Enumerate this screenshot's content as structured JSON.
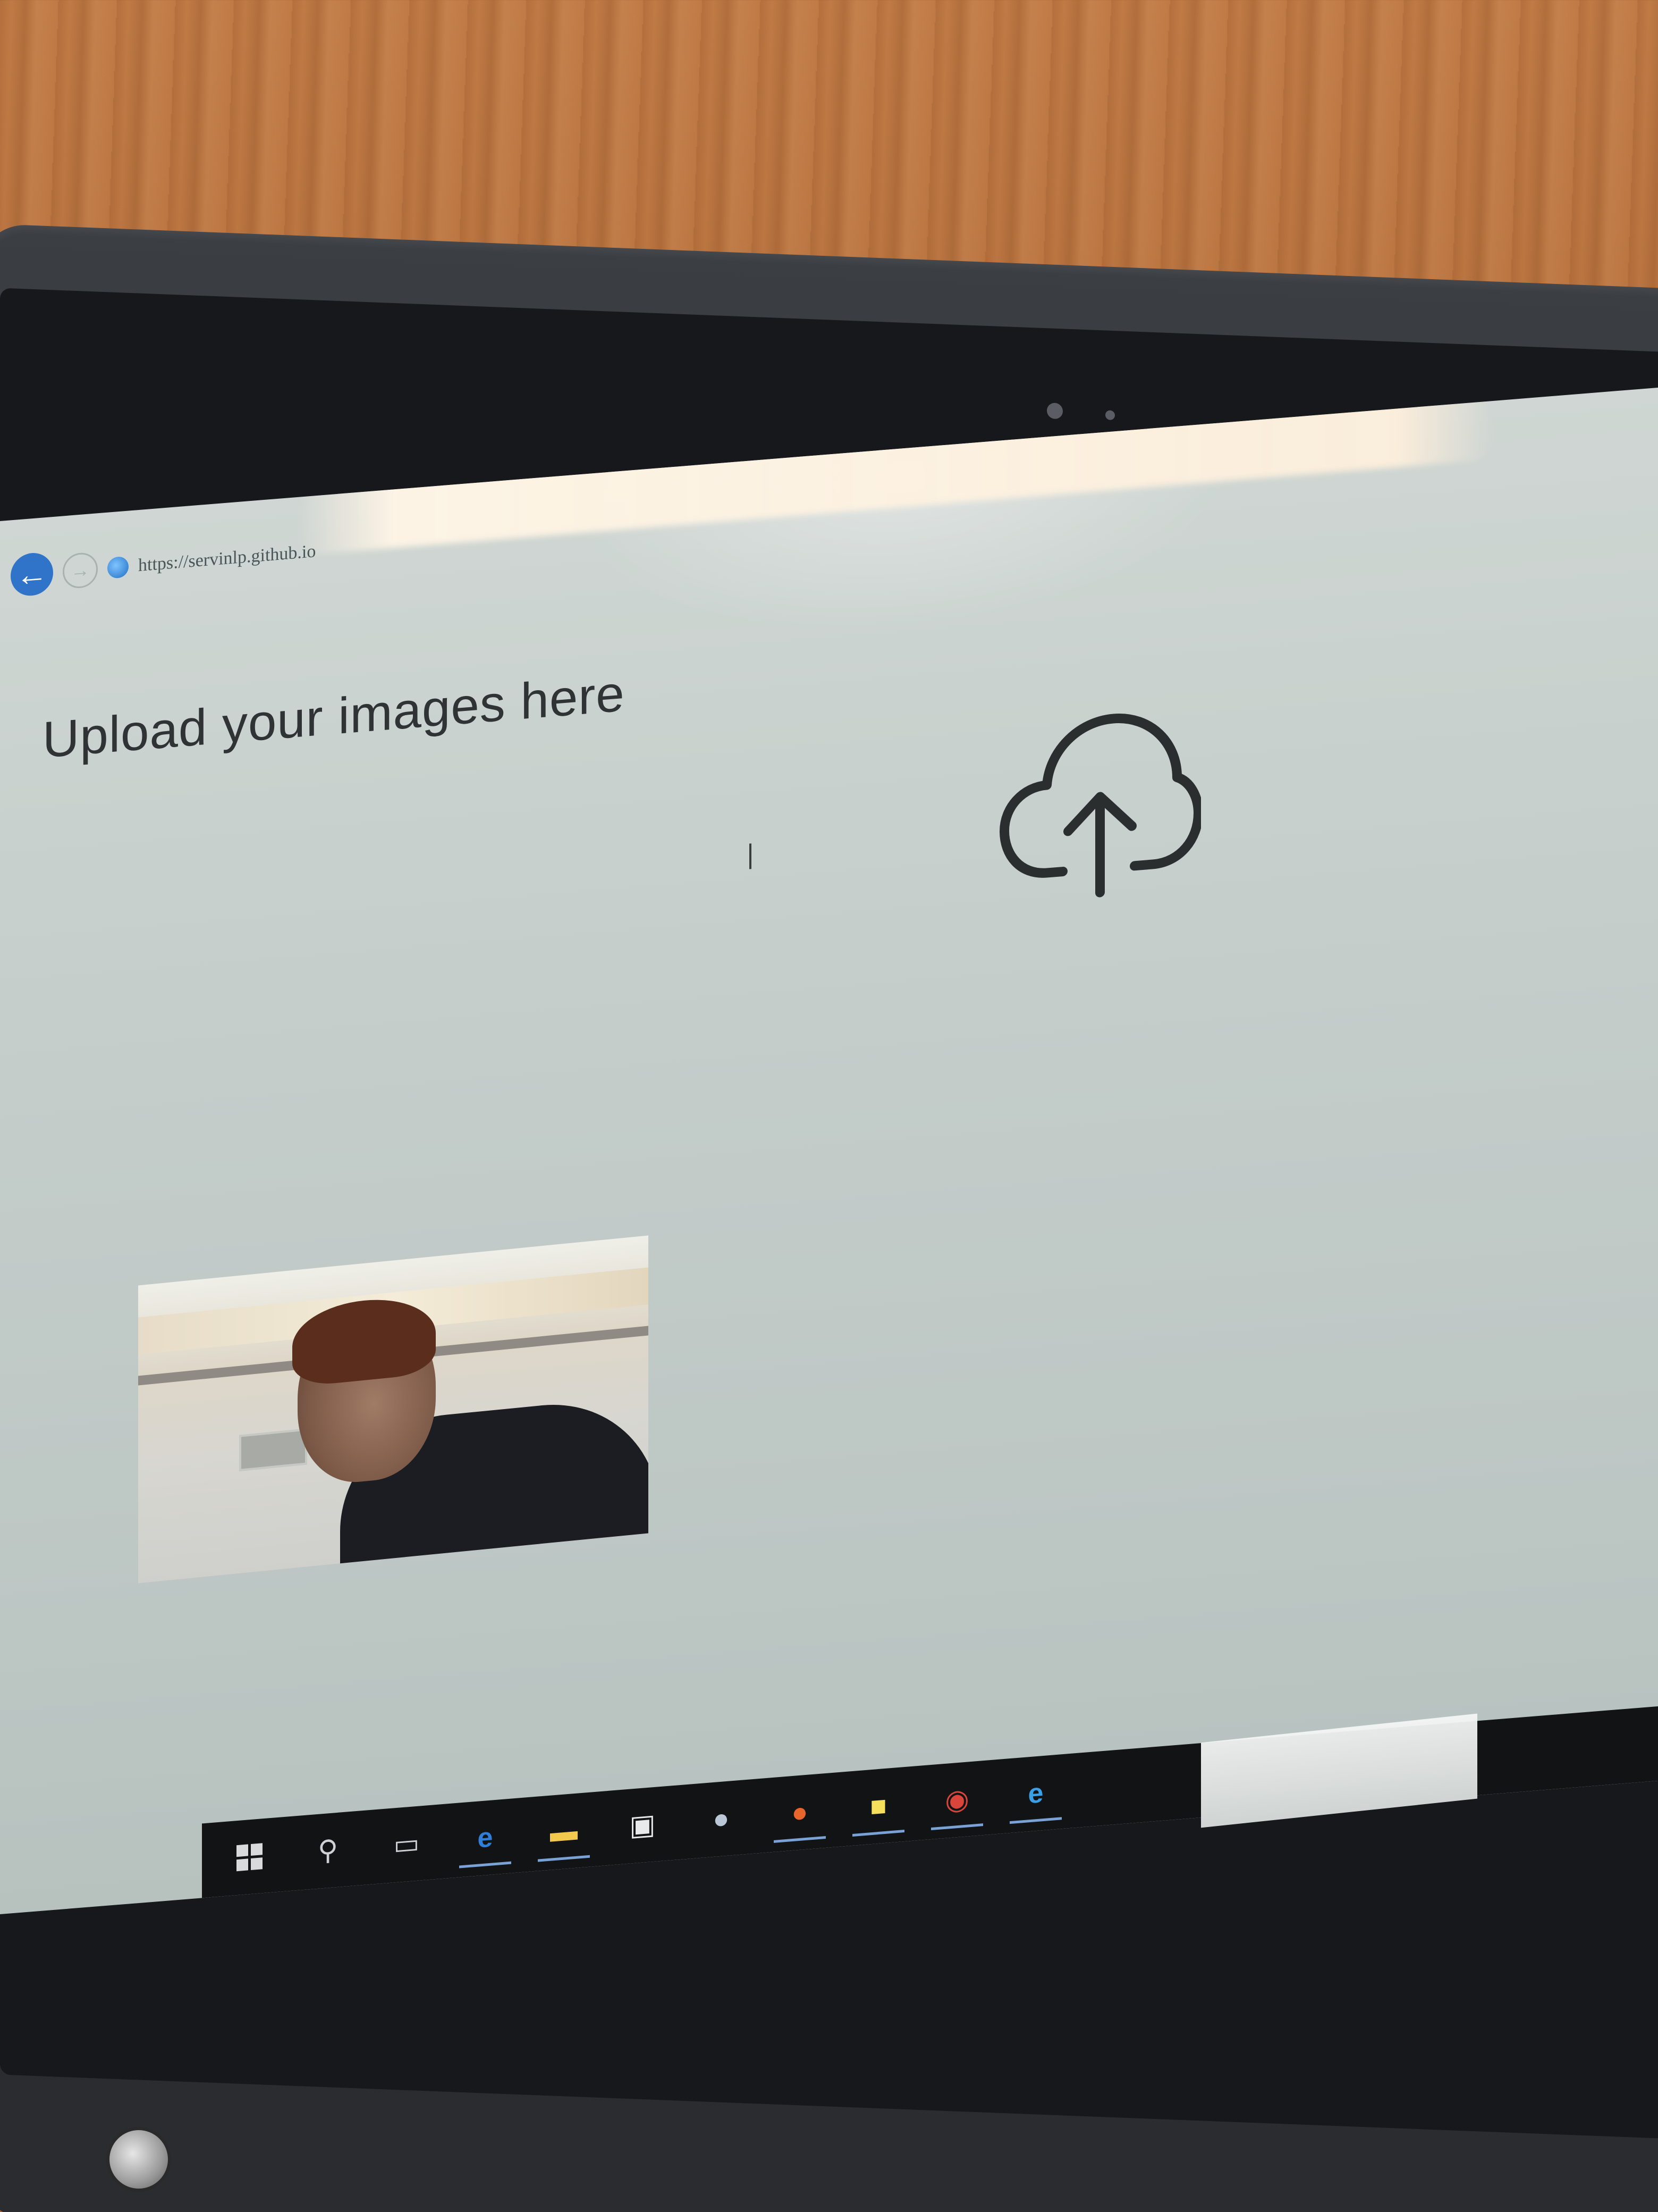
{
  "browser": {
    "url": "https://servinlp.github.io",
    "back_label": "←",
    "forward_label": "→"
  },
  "page": {
    "heading": "Upload your images here"
  },
  "upload": {
    "icon": "cloud-upload-icon"
  },
  "webcam": {
    "content": "webcam-preview-image"
  },
  "taskbar": {
    "icons": [
      "windows-start-icon",
      "search-icon",
      "task-view-icon",
      "edge-icon",
      "file-explorer-icon",
      "store-icon",
      "app-icon",
      "firefox-icon",
      "sticky-notes-icon",
      "chrome-icon",
      "internet-explorer-icon"
    ]
  },
  "colors": {
    "screen_bg": "#c4cdca",
    "heading_text": "#2f3334",
    "back_button": "#2f74c9",
    "taskbar_bg": "#121315"
  }
}
